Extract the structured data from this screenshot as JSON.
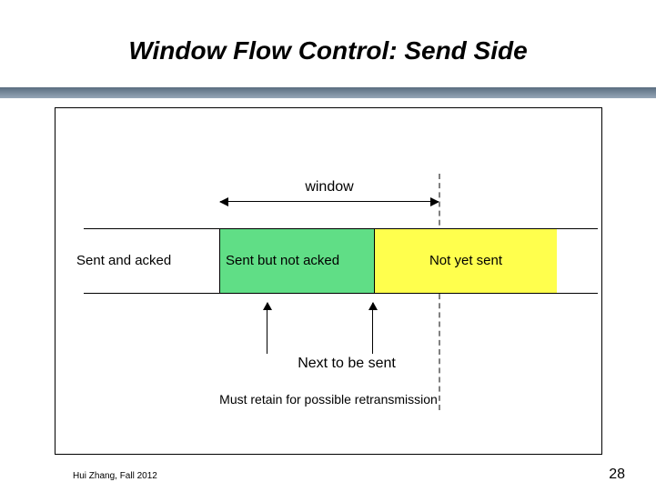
{
  "slide": {
    "title": "Window Flow Control: Send Side",
    "window_label": "window",
    "segments": {
      "sent_acked": "Sent and acked",
      "sent_not_acked": "Sent but not acked",
      "not_yet_sent": "Not yet sent"
    },
    "next_to_be_sent": "Next to be sent",
    "retain_note": "Must retain for possible retransmission",
    "footer_author": "Hui Zhang, Fall 2012",
    "page_number": "28"
  },
  "colors": {
    "sent_not_acked_bg": "#60de86",
    "not_yet_sent_bg": "#ffff4d",
    "rule_gradient_top": "#5a6d80",
    "rule_gradient_bottom": "#95a6b7",
    "dashed_edge": "#808080"
  }
}
